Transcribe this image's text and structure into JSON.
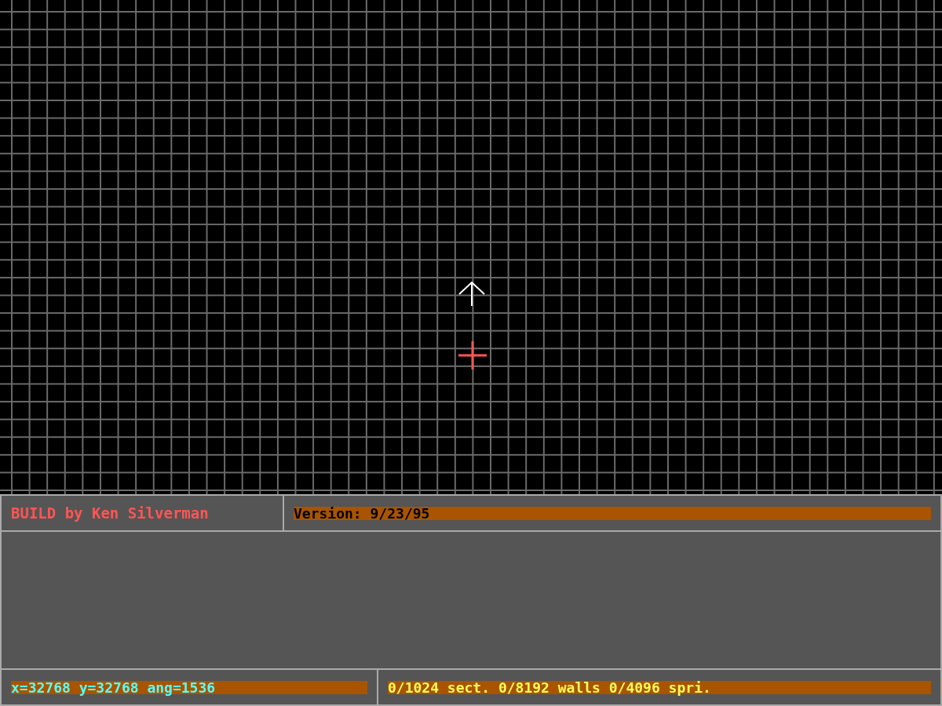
{
  "status_panel": {
    "title": "BUILD by Ken Silverman",
    "version": "Version: 9/23/95",
    "position": "x=32768 y=32768 ang=1536",
    "counts": "0/1024 sect. 0/8192 walls 0/4096 spri."
  }
}
